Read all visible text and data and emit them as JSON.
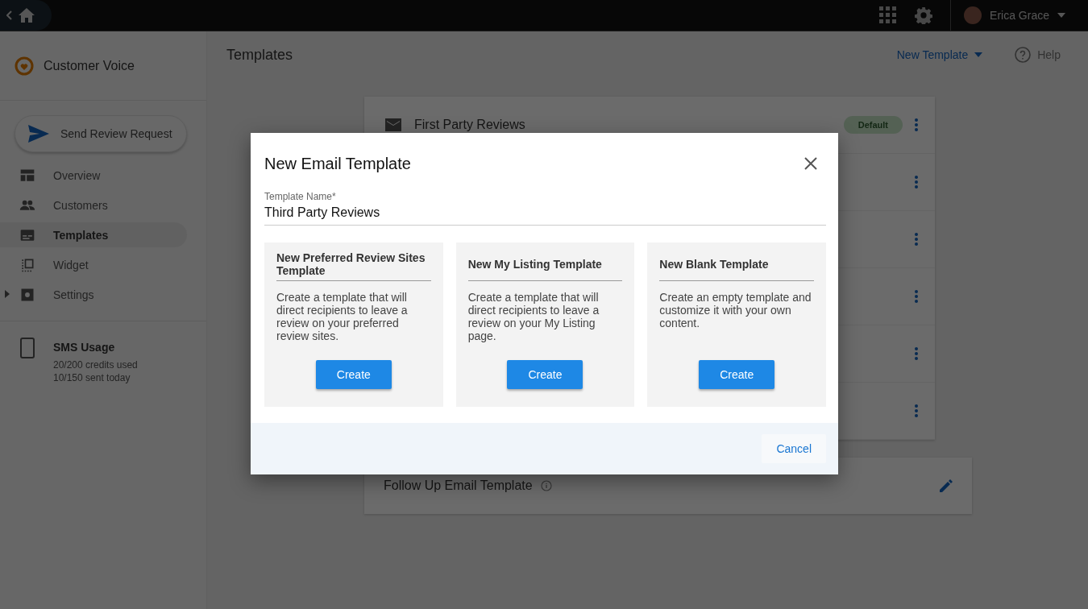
{
  "topbar": {
    "user_name": "Erica Grace"
  },
  "sidebar": {
    "app_name": "Customer Voice",
    "action_button": "Send Review Request",
    "items": [
      {
        "label": "Overview",
        "selected": false
      },
      {
        "label": "Customers",
        "selected": false
      },
      {
        "label": "Templates",
        "selected": true
      },
      {
        "label": "Widget",
        "selected": false
      },
      {
        "label": "Settings",
        "selected": false,
        "expanded": false
      }
    ],
    "sms_usage": {
      "title": "SMS Usage",
      "lines": [
        "20/200 credits used",
        "10/150 sent today"
      ]
    }
  },
  "header": {
    "title": "Templates",
    "new_button": "New Template",
    "help": "Help"
  },
  "template_rows": [
    {
      "title": "First Party Reviews",
      "badge": "Default"
    },
    {},
    {},
    {},
    {},
    {}
  ],
  "follow_up": {
    "title": "Follow Up Email Template"
  },
  "dialog": {
    "title": "New Email Template",
    "field_label": "Template Name*",
    "field_value": "Third Party Reviews",
    "options": [
      {
        "title": "New Preferred Review Sites Template",
        "description": "Create a template that will direct recipients to leave a review on your preferred review sites.",
        "button": "Create"
      },
      {
        "title": "New My Listing Template",
        "description": "Create a template that will direct recipients to leave a review on your My Listing page.",
        "button": "Create"
      },
      {
        "title": "New Blank Template",
        "description": "Create an empty template and customize it with your own content.",
        "button": "Create"
      }
    ],
    "cancel": "Cancel"
  }
}
